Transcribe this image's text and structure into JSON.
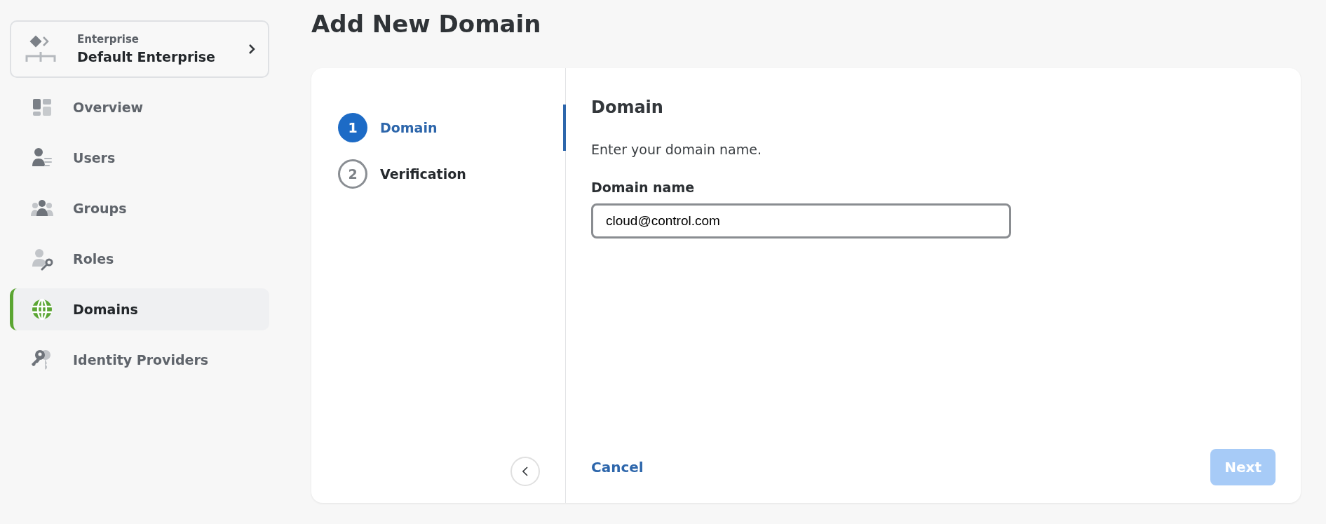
{
  "sidebar": {
    "enterprise": {
      "label": "Enterprise",
      "name": "Default Enterprise"
    },
    "items": [
      {
        "kind": "overview",
        "label": "Overview",
        "selected": false
      },
      {
        "kind": "users",
        "label": "Users",
        "selected": false
      },
      {
        "kind": "groups",
        "label": "Groups",
        "selected": false
      },
      {
        "kind": "roles",
        "label": "Roles",
        "selected": false
      },
      {
        "kind": "domains",
        "label": "Domains",
        "selected": true
      },
      {
        "kind": "identity",
        "label": "Identity Providers",
        "selected": false
      }
    ]
  },
  "page": {
    "title": "Add New Domain"
  },
  "steps": [
    {
      "number": "1",
      "label": "Domain",
      "selected": true
    },
    {
      "number": "2",
      "label": "Verification",
      "selected": false
    }
  ],
  "form": {
    "heading": "Domain",
    "description": "Enter your domain name.",
    "field": {
      "label": "Domain name",
      "value": "cloud@control.com"
    }
  },
  "footer": {
    "cancel": "Cancel",
    "next": {
      "label": "Next",
      "disabled": true
    }
  }
}
